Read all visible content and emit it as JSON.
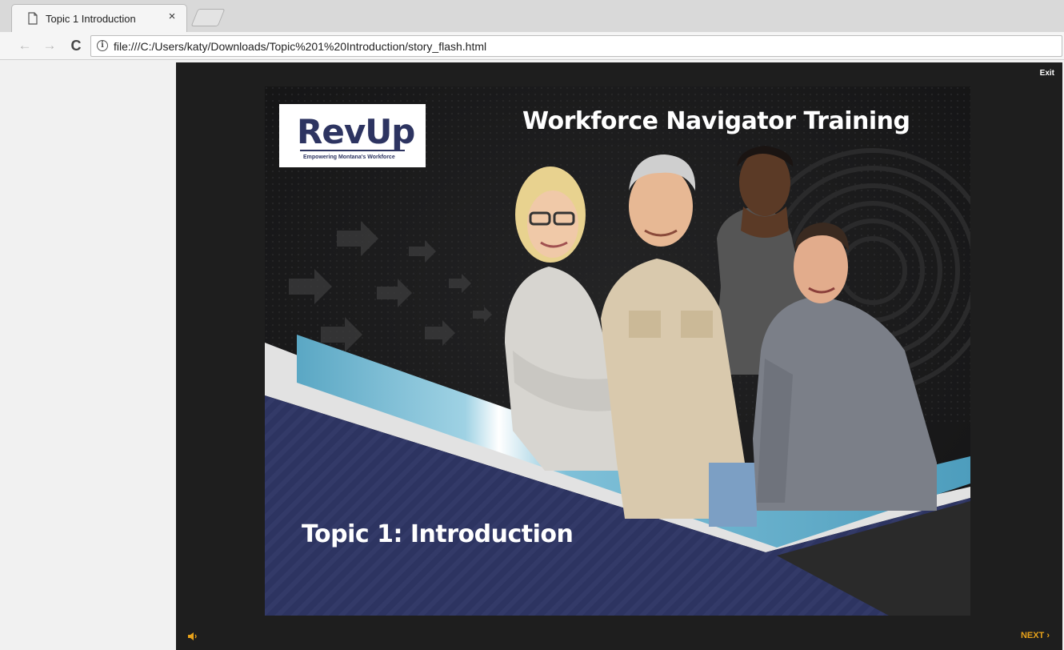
{
  "browser": {
    "tab": {
      "title": "Topic 1 Introduction",
      "close_glyph": "×",
      "icon": "page-icon"
    },
    "nav": {
      "back_glyph": "←",
      "forward_glyph": "→",
      "reload_glyph": "C"
    },
    "address": {
      "info_glyph": "i",
      "url": "file:///C:/Users/katy/Downloads/Topic%201%20Introduction/story_flash.html"
    }
  },
  "player": {
    "exit_label": "Exit",
    "next_label": "NEXT ›",
    "volume_icon": "speaker-icon",
    "accent_color": "#e8a21a"
  },
  "slide": {
    "logo": {
      "word": "RevUp",
      "tagline": "Empowering Montana's Workforce"
    },
    "title": "Workforce Navigator Training",
    "topic": "Topic 1: Introduction",
    "colors": {
      "navy": "#2d3461",
      "teal": "#5aa7c4",
      "background": "#1b1b1c"
    }
  }
}
